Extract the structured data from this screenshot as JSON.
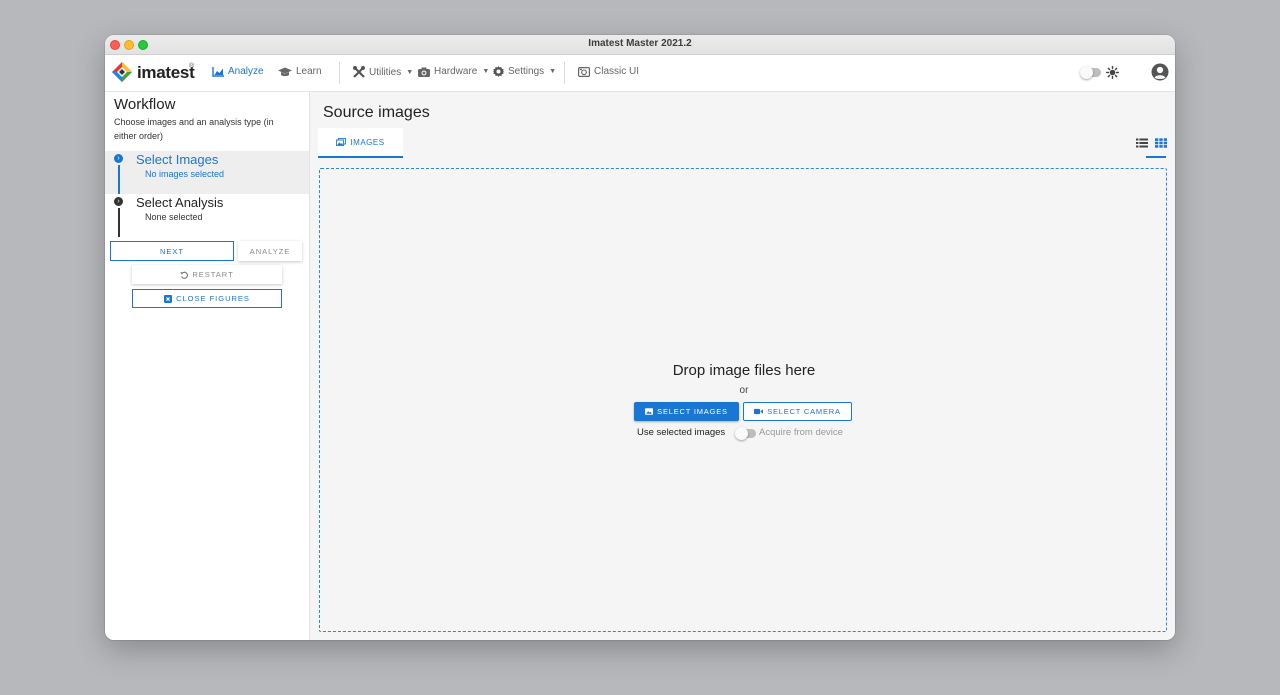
{
  "window": {
    "title": "Imatest Master 2021.2"
  },
  "app": {
    "logo_text": "imatest",
    "logo_mark": "®"
  },
  "nav": {
    "analyze": "Analyze",
    "learn": "Learn",
    "utilities": "Utilities",
    "hardware": "Hardware",
    "settings": "Settings",
    "classic_ui": "Classic UI"
  },
  "colors": {
    "accent": "#1976d2",
    "dark_step": "#333333"
  },
  "icons": {
    "analyze": "chart-icon",
    "learn": "graduation-cap-icon",
    "utilities": "tools-icon",
    "hardware": "camera-icon",
    "settings": "gear-icon",
    "classic_ui": "classic-camera-icon",
    "theme": "sun-icon",
    "account": "user-circle-icon"
  },
  "sidebar": {
    "title": "Workflow",
    "subtitle": "Choose images and an analysis type (in either order)",
    "steps": [
      {
        "title": "Select Images",
        "subtitle": "No images selected",
        "active": true
      },
      {
        "title": "Select Analysis",
        "subtitle": "None selected",
        "active": false
      }
    ],
    "buttons": {
      "next": "NEXT",
      "analyze": "ANALYZE",
      "restart": "RESTART",
      "close_figures": "CLOSE FIGURES"
    }
  },
  "main": {
    "title": "Source images",
    "tab": "IMAGES",
    "dropzone": {
      "title": "Drop image files here",
      "or": "or",
      "select_images": "SELECT IMAGES",
      "select_camera": "SELECT CAMERA",
      "use_selected": "Use selected images",
      "acquire": "Acquire from device"
    }
  }
}
